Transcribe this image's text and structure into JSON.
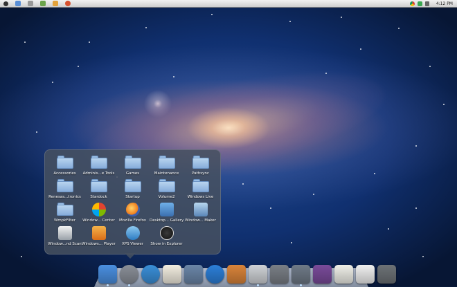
{
  "menubar": {
    "clock": "4:12 PM",
    "left_icons": [
      "apple-icon",
      "app-icon-1",
      "app-icon-2",
      "app-icon-3",
      "app-icon-4",
      "app-icon-5"
    ],
    "right_icons": [
      "chrome-icon",
      "wifi-icon",
      "volume-icon"
    ]
  },
  "stack": {
    "items": [
      {
        "label": "Accessories",
        "icon": "folder-icon"
      },
      {
        "label": "Adminis...e Tools",
        "icon": "folder-icon"
      },
      {
        "label": "Games",
        "icon": "folder-icon"
      },
      {
        "label": "Maintenance",
        "icon": "folder-icon"
      },
      {
        "label": "Pathsync",
        "icon": "folder-icon"
      },
      {
        "label": "Renesas...tronics",
        "icon": "folder-icon"
      },
      {
        "label": "Stardock",
        "icon": "folder-icon"
      },
      {
        "label": "Startup",
        "icon": "folder-icon"
      },
      {
        "label": "Volume2",
        "icon": "folder-icon"
      },
      {
        "label": "Windows Live",
        "icon": "folder-icon"
      },
      {
        "label": "WmpkFilter",
        "icon": "folder-icon"
      },
      {
        "label": "Window... Center",
        "icon": "windows-media-center-icon"
      },
      {
        "label": "Mozilla Firefox",
        "icon": "firefox-icon"
      },
      {
        "label": "Desktop... Gallery",
        "icon": "gadget-gallery-icon"
      },
      {
        "label": "Window... Maker",
        "icon": "movie-maker-icon"
      },
      {
        "label": "Window...nd Scan",
        "icon": "fax-scan-icon"
      },
      {
        "label": "Windows... Player",
        "icon": "media-player-icon"
      },
      {
        "label": "XPS Viewer",
        "icon": "xps-viewer-icon"
      },
      {
        "label": "Show in Explorer",
        "icon": "show-in-explorer-icon"
      }
    ]
  },
  "dock": {
    "items": [
      {
        "name": "finder",
        "icon": "finder-icon",
        "color": "#4a8fe0",
        "running": true
      },
      {
        "name": "launchpad",
        "icon": "rocket-icon",
        "color": "#8a8f98",
        "running": true
      },
      {
        "name": "safari",
        "icon": "safari-compass-icon",
        "color": "#3a8fd8",
        "running": false
      },
      {
        "name": "notes",
        "icon": "document-icon",
        "color": "#f2ede0",
        "running": false
      },
      {
        "name": "preview",
        "icon": "photo-icon",
        "color": "#6b86a8",
        "running": false
      },
      {
        "name": "itunes",
        "icon": "music-note-icon",
        "color": "#2c7fd8",
        "running": false
      },
      {
        "name": "home",
        "icon": "home-icon",
        "color": "#d9843a",
        "running": false
      },
      {
        "name": "blank-app",
        "icon": "app-icon",
        "color": "#cfd2d6",
        "running": true
      },
      {
        "name": "system-preferences",
        "icon": "gear-icon",
        "color": "#7a7f86",
        "running": false
      },
      {
        "name": "stack",
        "icon": "stack-icon",
        "color": "#6f7a87",
        "running": true
      },
      {
        "name": "mission-control",
        "icon": "desktop-wallpaper-icon",
        "color": "#7a4b9a",
        "running": false
      },
      {
        "name": "documents",
        "icon": "documents-icon",
        "color": "#efefe8",
        "running": false
      },
      {
        "name": "text-file",
        "icon": "text-file-icon",
        "color": "#f0f0f0",
        "running": false
      },
      {
        "name": "trash",
        "icon": "trash-icon",
        "color": "#6d7276",
        "running": false
      }
    ]
  }
}
